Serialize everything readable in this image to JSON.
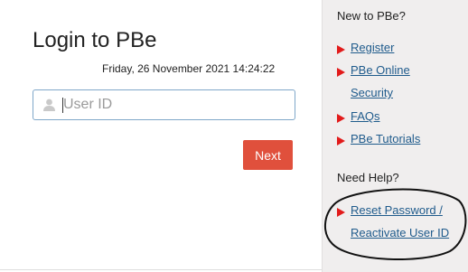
{
  "login": {
    "title": "Login to PBe",
    "datetime": "Friday, 26 November 2021 14:24:22",
    "userid_placeholder": "User ID",
    "next_label": "Next"
  },
  "sidebar": {
    "new_heading": "New to PBe?",
    "links": [
      {
        "label": "Register"
      },
      {
        "label_line1": "PBe Online",
        "label_line2": "Security"
      },
      {
        "label": "FAQs"
      },
      {
        "label": "PBe Tutorials"
      }
    ],
    "help_heading": "Need Help?",
    "help_link": {
      "label_line1": "Reset Password /",
      "label_line2": "Reactivate User ID"
    }
  },
  "colors": {
    "accent_button": "#e0503c",
    "link": "#1f5b8c",
    "arrow": "#e21b1b",
    "sidebar_bg": "#f0eeee"
  },
  "icons": [
    "user-icon",
    "arrow-right-icon"
  ]
}
